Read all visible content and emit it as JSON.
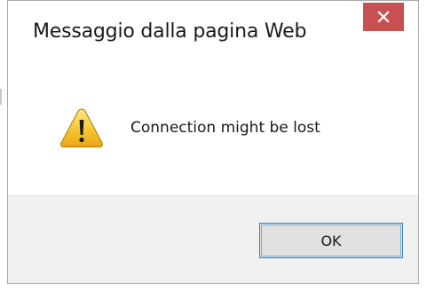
{
  "window": {
    "title": "Messaggio dalla pagina Web",
    "close_icon": "close-icon",
    "close_color": "#c75050"
  },
  "content": {
    "icon": "warning-icon",
    "message": "Connection might be lost"
  },
  "buttons": {
    "ok_label": "OK",
    "accent": "#3c7fb1"
  }
}
